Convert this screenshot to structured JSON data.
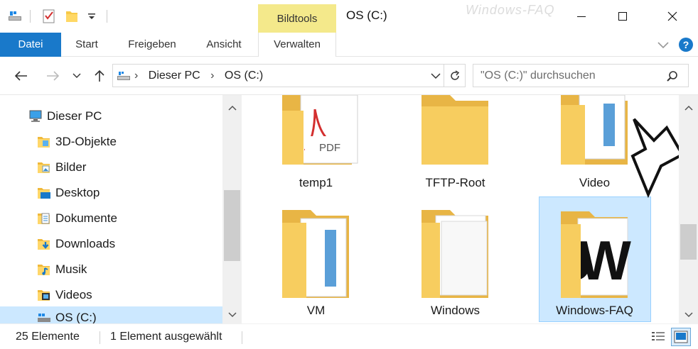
{
  "window": {
    "contextual_tab_group": "Bildtools",
    "title": "OS (C:)",
    "watermark": "Windows-FAQ"
  },
  "ribbon": {
    "tabs": [
      {
        "label": "Datei"
      },
      {
        "label": "Start"
      },
      {
        "label": "Freigeben"
      },
      {
        "label": "Ansicht"
      },
      {
        "label": "Verwalten"
      }
    ]
  },
  "address": {
    "breadcrumb": [
      "Dieser PC",
      "OS (C:)"
    ],
    "search_placeholder": "\"OS (C:)\" durchsuchen"
  },
  "navigation": {
    "items": [
      {
        "label": "Dieser PC",
        "icon": "pc-icon"
      },
      {
        "label": "3D-Objekte",
        "icon": "folder-3d-icon"
      },
      {
        "label": "Bilder",
        "icon": "folder-pictures-icon"
      },
      {
        "label": "Desktop",
        "icon": "folder-desktop-icon"
      },
      {
        "label": "Dokumente",
        "icon": "folder-documents-icon"
      },
      {
        "label": "Downloads",
        "icon": "folder-downloads-icon"
      },
      {
        "label": "Musik",
        "icon": "folder-music-icon"
      },
      {
        "label": "Videos",
        "icon": "folder-videos-icon"
      },
      {
        "label": "OS (C:)",
        "icon": "drive-icon"
      }
    ]
  },
  "content": {
    "items": [
      {
        "label": "temp1",
        "icon": "folder-pdf-icon"
      },
      {
        "label": "TFTP-Root",
        "icon": "folder-icon"
      },
      {
        "label": "Video",
        "icon": "folder-docs-icon"
      },
      {
        "label": "VM",
        "icon": "folder-docs-icon"
      },
      {
        "label": "Windows",
        "icon": "folder-files-icon"
      },
      {
        "label": "Windows-FAQ",
        "icon": "folder-logo-icon",
        "selected": true
      }
    ]
  },
  "status": {
    "count": "25 Elemente",
    "selection": "1 Element ausgewählt"
  }
}
